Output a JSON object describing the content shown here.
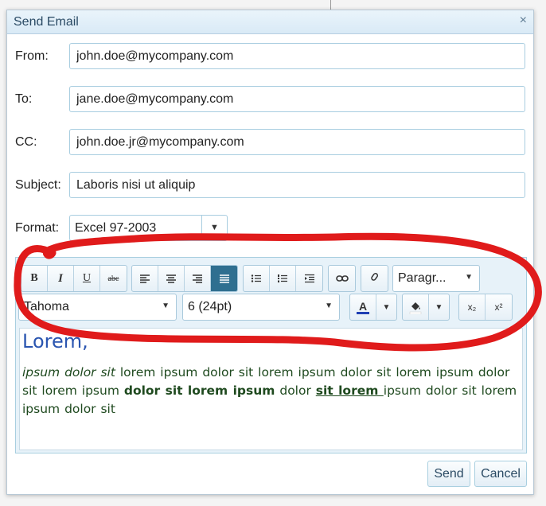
{
  "window": {
    "title": "Send Email",
    "close_glyph": "×"
  },
  "form": {
    "from": {
      "label": "From:",
      "value": "john.doe@mycompany.com"
    },
    "to": {
      "label": "To:",
      "value": "jane.doe@mycompany.com"
    },
    "cc": {
      "label": "CC:",
      "value": "john.doe.jr@mycompany.com"
    },
    "subject": {
      "label": "Subject:",
      "value": "Laboris nisi ut aliquip"
    },
    "format": {
      "label": "Format:",
      "value": "Excel 97-2003",
      "arrow": "▼"
    }
  },
  "toolbar": {
    "bold": "B",
    "italic": "I",
    "underline": "U",
    "strike": "abc",
    "block_format": "Paragr...",
    "font_name": "Tahoma",
    "font_size": "6 (24pt)",
    "font_color_letter": "A",
    "font_color": "#1f3fb4",
    "subscript": "x₂",
    "superscript": "x²",
    "dropdown_arrow": "▼",
    "active_alignment": "justify"
  },
  "content": {
    "heading": "Lorem,",
    "p_italic": "ipsum dolor sit",
    "p_text1": " lorem ipsum dolor sit lorem ipsum dolor sit lorem ipsum dolor sit lorem ipsum ",
    "p_bold": "dolor sit lorem ipsum",
    "p_text2": " dolor ",
    "p_underline": "sit lorem ",
    "p_text3": "ipsum dolor sit lorem ipsum dolor sit"
  },
  "buttons": {
    "send": "Send",
    "cancel": "Cancel"
  },
  "colors": {
    "accent": "#2f6f90",
    "annotation": "#e01b1b",
    "heading": "#2a55b0",
    "body_text": "#1f4a1f"
  }
}
